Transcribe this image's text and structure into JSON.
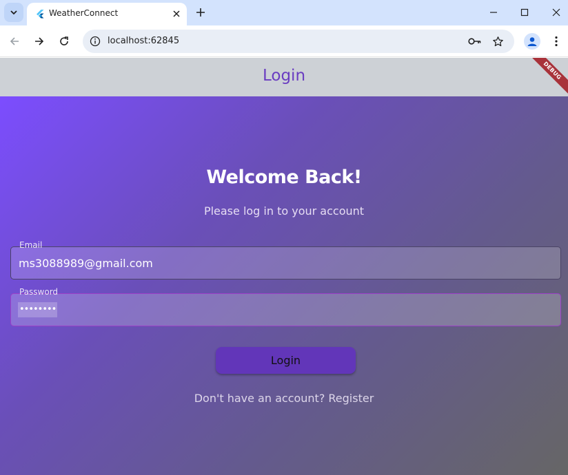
{
  "browser": {
    "tab_title": "WeatherConnect",
    "url": "localhost:62845",
    "icons": {
      "tab_search": "chevron-down-icon",
      "favicon": "flutter-logo-icon",
      "tab_close": "close-icon",
      "new_tab": "plus-icon",
      "minimize": "minimize-icon",
      "maximize": "maximize-icon",
      "window_close": "close-icon",
      "back": "arrow-left-icon",
      "forward": "arrow-right-icon",
      "reload": "reload-icon",
      "site_info": "info-icon",
      "password": "key-icon",
      "bookmark": "star-icon",
      "profile": "account-icon",
      "menu": "kebab-menu-icon"
    }
  },
  "app": {
    "appbar_title": "Login",
    "debug_banner": "DEBUG",
    "welcome": "Welcome Back!",
    "subtitle": "Please log in to your account",
    "email": {
      "label": "Email",
      "value": "ms3088989@gmail.com"
    },
    "password": {
      "label": "Password",
      "value": "••••••••"
    },
    "login_button": "Login",
    "register_link": "Don't have an account? Register"
  },
  "colors": {
    "tab_strip": "#d3e3fd",
    "appbar_bg": "#cdd1d6",
    "appbar_title": "#6a3dc1",
    "gradient_start": "#7c4dff",
    "gradient_end": "#666666",
    "login_button": "#6236b9",
    "debug_banner": "#a8323a",
    "password_border": "#9c3fc8"
  }
}
